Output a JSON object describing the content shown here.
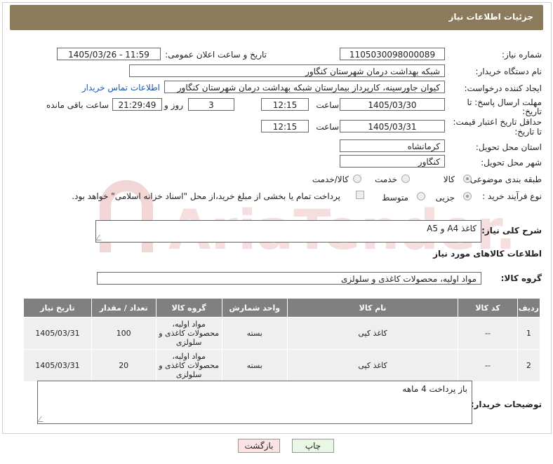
{
  "header": {
    "title": "جزئیات اطلاعات نیاز"
  },
  "fields": {
    "need_number_label": "شماره نیاز:",
    "need_number": "1105030098000089",
    "announce_label": "تاریخ و ساعت اعلان عمومی:",
    "announce_value": "1405/03/26 - 11:59",
    "buyer_label": "نام دستگاه خریدار:",
    "buyer_value": "شبکه بهداشت درمان شهرستان کنگاور",
    "requester_label": "ایجاد کننده درخواست:",
    "requester_value": "کیوان جاورسینه، کارپرداز بیمارستان شبکه بهداشت درمان شهرستان کنگاور",
    "contact_link": "اطلاعات تماس خریدار",
    "deadline_label_1": "مهلت ارسال پاسخ: تا",
    "deadline_label_2": "تاریخ:",
    "deadline_date": "1405/03/30",
    "time_label": "ساعت",
    "deadline_time": "12:15",
    "days_value": "3",
    "days_label": "روز و",
    "remaining_time": "21:29:49",
    "remaining_label": "ساعت باقی مانده",
    "validity_label_1": "حداقل تاریخ اعتبار قیمت:",
    "validity_label_2": "تا تاریخ:",
    "validity_date": "1405/03/31",
    "validity_time": "12:15",
    "province_label": "استان محل تحویل:",
    "province_value": "کرمانشاه",
    "city_label": "شهر محل تحویل:",
    "city_value": "کنگاور",
    "category_label": "طبقه بندی موضوعی:",
    "category_options": [
      "کالا",
      "خدمت",
      "کالا/خدمت"
    ],
    "process_label": "نوع فرآیند خرید :",
    "process_options": [
      "جزیی",
      "متوسط"
    ],
    "payment_text": "پرداخت تمام یا بخشی از مبلغ خرید،از محل \"اسناد خزانه اسلامی\" خواهد بود.",
    "desc_label": "شرح کلی نیاز:",
    "desc_value": "کاغذ A4 و A5",
    "goods_info_label": "اطلاعات کالاهای مورد نیاز",
    "group_label": "گروه کالا:",
    "group_value": "مواد اولیه، محصولات کاغذی و سلولزی",
    "buyer_notes_label": "توضیحات خریدار:",
    "buyer_notes_value": "باز پرداخت 4 ماهه"
  },
  "table": {
    "headers": [
      "ردیف",
      "کد کالا",
      "نام کالا",
      "واحد شمارش",
      "گروه کالا",
      "تعداد / مقدار",
      "تاریخ نیاز"
    ],
    "rows": [
      [
        "1",
        "--",
        "کاغذ کپی",
        "بسته",
        "مواد اولیه، محصولات کاغذی و سلولزی",
        "100",
        "1405/03/31"
      ],
      [
        "2",
        "--",
        "کاغذ کپی",
        "بسته",
        "مواد اولیه، محصولات کاغذی و سلولزی",
        "20",
        "1405/03/31"
      ]
    ]
  },
  "buttons": {
    "print": "چاپ",
    "back": "بازگشت"
  },
  "watermark": {
    "text": "AriaTender.neT"
  }
}
